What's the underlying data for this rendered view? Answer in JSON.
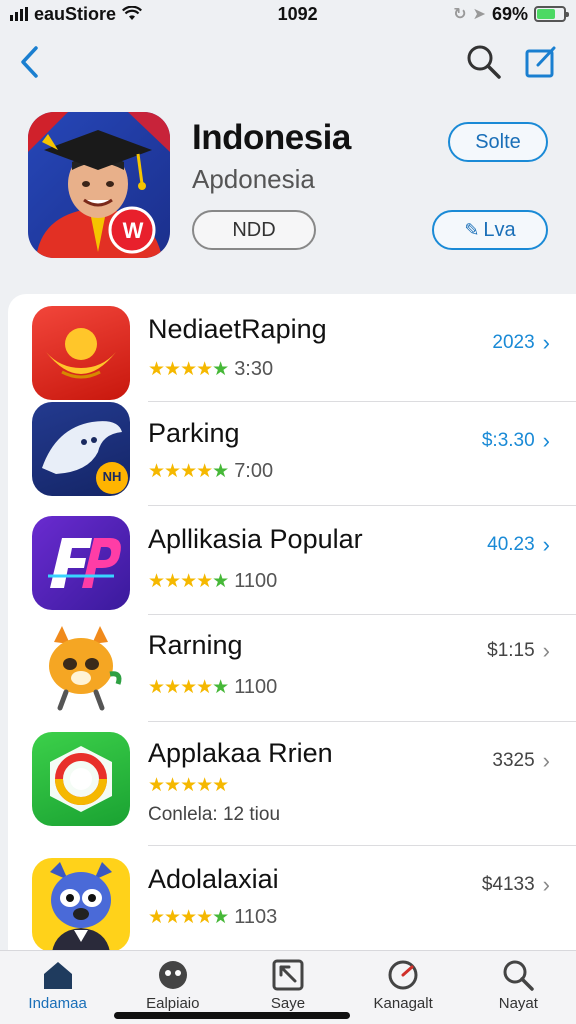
{
  "status_bar": {
    "carrier": "eauStiore",
    "time": "1092",
    "battery_pct": "69%",
    "battery_level": 0.69
  },
  "nav": {
    "back_icon": "chevron-left-icon",
    "search_icon": "search-icon",
    "compose_icon": "compose-icon"
  },
  "app": {
    "title": "Indonesia",
    "subtitle": "Apdonesia",
    "badge_text": "NDD",
    "primary_button": "Solte",
    "secondary_button": "Lva",
    "icon_badge": "W"
  },
  "list": [
    {
      "name": "NediaetRaping",
      "rating_text": "3:30",
      "price": "2023",
      "price_color": "#1a8ad6",
      "stars": 5
    },
    {
      "name": "Parking",
      "rating_text": "7:00",
      "price": "$:3.30",
      "price_color": "#1a8ad6",
      "stars": 5,
      "icon_badge": "NH"
    },
    {
      "name": "Apllikasia Popular",
      "rating_text": "1100",
      "price": "40.23",
      "price_color": "#1a8ad6",
      "stars": 5
    },
    {
      "name": "Rarning",
      "rating_text": "1100",
      "price": "$1:15",
      "price_color": "#444444",
      "stars": 5
    },
    {
      "name": "Applakaa Rrien",
      "rating_text": "",
      "caption": "Conlela: 12 tiou",
      "price": "3325",
      "price_color": "#444444",
      "stars": 5
    },
    {
      "name": "Adolalaxiai",
      "rating_text": "1103",
      "price": "$4133",
      "price_color": "#444444",
      "stars": 5
    }
  ],
  "tabs": [
    {
      "label": "Indamaa",
      "icon": "home-icon",
      "active": true
    },
    {
      "label": "Ealpiaio",
      "icon": "face-icon",
      "active": false
    },
    {
      "label": "Saye",
      "icon": "save-icon",
      "active": false
    },
    {
      "label": "Kanagalt",
      "icon": "gauge-icon",
      "active": false
    },
    {
      "label": "Nayat",
      "icon": "search-icon",
      "active": false
    }
  ],
  "colors": {
    "accent": "#1a8ad6",
    "star": "#f5b800",
    "star_last": "#46b838"
  }
}
